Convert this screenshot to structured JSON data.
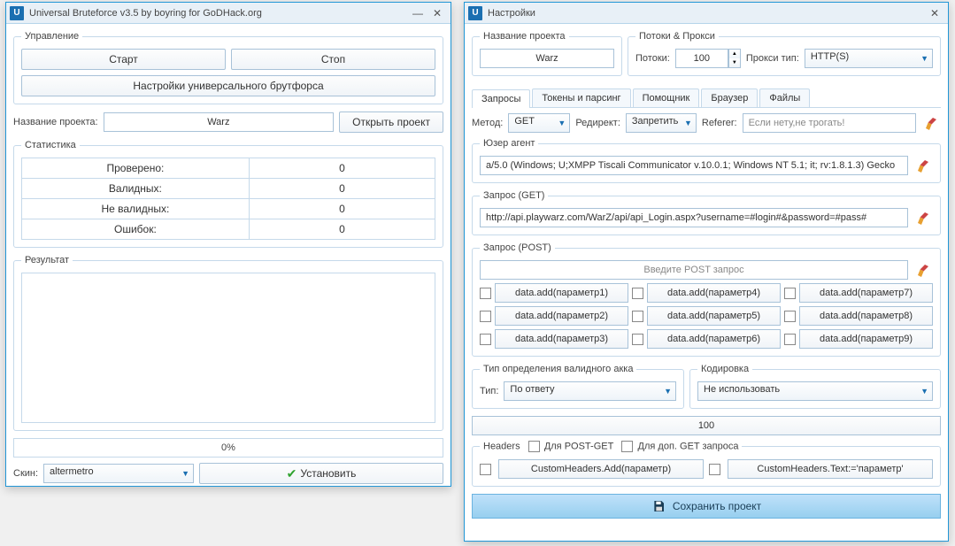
{
  "main": {
    "title": "Universal Bruteforce v3.5 by boyring for GoDHack.org",
    "management": {
      "legend": "Управление",
      "start": "Старт",
      "stop": "Стоп",
      "settings": "Настройки универсального брутфорса"
    },
    "project_name_label": "Название проекта:",
    "project_value": "Warz",
    "open_project": "Открыть проект",
    "stats": {
      "legend": "Статистика",
      "checked": "Проверено:",
      "checked_v": "0",
      "valid": "Валидных:",
      "valid_v": "0",
      "invalid": "Не валидных:",
      "invalid_v": "0",
      "errors": "Ошибок:",
      "errors_v": "0"
    },
    "result_legend": "Результат",
    "progress": "0%",
    "skin_label": "Скин:",
    "skin_value": "altermetro",
    "install": "Установить"
  },
  "settings": {
    "title": "Настройки",
    "proj_legend": "Название проекта",
    "proj_value": "Warz",
    "threads_legend": "Потоки & Прокси",
    "threads_label": "Потоки:",
    "threads_value": "100",
    "proxy_label": "Прокси тип:",
    "proxy_value": "HTTP(S)",
    "tabs": [
      "Запросы",
      "Токены и парсинг",
      "Помощник",
      "Браузер",
      "Файлы"
    ],
    "method_label": "Метод:",
    "method_value": "GET",
    "redirect_label": "Редирект:",
    "redirect_value": "Запретить",
    "referer_label": "Referer:",
    "referer_ph": "Если нету,не трогать!",
    "ua_legend": "Юзер агент",
    "ua_value": "a/5.0 (Windows; U;XMPP Tiscali Communicator v.10.0.1; Windows NT 5.1; it; rv:1.8.1.3) Gecko",
    "get_legend": "Запрос (GET)",
    "get_value": "http://api.playwarz.com/WarZ/api/api_Login.aspx?username=#login#&password=#pass#",
    "post_legend": "Запрос (POST)",
    "post_ph": "Введите POST запрос",
    "params": [
      "data.add(параметр1)",
      "data.add(параметр4)",
      "data.add(параметр7)",
      "data.add(параметр2)",
      "data.add(параметр5)",
      "data.add(параметр8)",
      "data.add(параметр3)",
      "data.add(параметр6)",
      "data.add(параметр9)"
    ],
    "validtype_legend": "Тип определения валидного акка",
    "validtype_label": "Тип:",
    "validtype_value": "По ответу",
    "encoding_legend": "Кодировка",
    "encoding_value": "Не использовать",
    "hundred": "100",
    "headers_legend": "Headers",
    "headers_chk1": "Для POST-GET",
    "headers_chk2": "Для доп. GET запроса",
    "headers_btn1": "CustomHeaders.Add(параметр)",
    "headers_btn2": "CustomHeaders.Text:='параметр'",
    "save": "Сохранить проект"
  }
}
